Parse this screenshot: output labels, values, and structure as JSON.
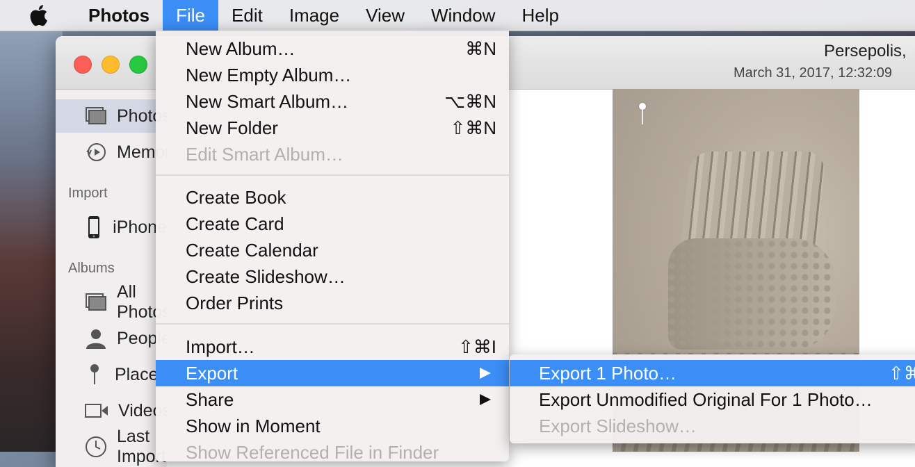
{
  "menubar": {
    "app_name": "Photos",
    "items": [
      "File",
      "Edit",
      "Image",
      "View",
      "Window",
      "Help"
    ]
  },
  "window": {
    "title": "Persepolis,",
    "subtitle": "March 31, 2017, 12:32:09"
  },
  "sidebar": {
    "items": [
      {
        "label": "Photos",
        "icon": "photos-icon",
        "selected": true
      },
      {
        "label": "Memories",
        "icon": "memories-icon"
      }
    ],
    "import_header": "Import",
    "import_items": [
      {
        "label": "iPhone",
        "icon": "iphone-icon"
      }
    ],
    "albums_header": "Albums",
    "album_items": [
      {
        "label": "All Photos",
        "icon": "all-photos-icon"
      },
      {
        "label": "People",
        "icon": "people-icon"
      },
      {
        "label": "Places",
        "icon": "places-icon"
      },
      {
        "label": "Videos",
        "icon": "videos-icon"
      },
      {
        "label": "Last Import",
        "icon": "clock-icon"
      }
    ]
  },
  "file_menu": {
    "group1": [
      {
        "label": "New Album…",
        "shortcut": "⌘N"
      },
      {
        "label": "New Empty Album…",
        "shortcut": ""
      },
      {
        "label": "New Smart Album…",
        "shortcut": "⌥⌘N"
      },
      {
        "label": "New Folder",
        "shortcut": "⇧⌘N"
      },
      {
        "label": "Edit Smart Album…",
        "shortcut": "",
        "disabled": true
      }
    ],
    "group2": [
      {
        "label": "Create Book"
      },
      {
        "label": "Create Card"
      },
      {
        "label": "Create Calendar"
      },
      {
        "label": "Create Slideshow…"
      },
      {
        "label": "Order Prints"
      }
    ],
    "group3": [
      {
        "label": "Import…",
        "shortcut": "⇧⌘I"
      },
      {
        "label": "Export",
        "submenu": true,
        "highlighted": true
      },
      {
        "label": "Share",
        "submenu": true
      },
      {
        "label": "Show in Moment"
      },
      {
        "label": "Show Referenced File in Finder",
        "disabled": true
      }
    ]
  },
  "export_submenu": [
    {
      "label": "Export 1 Photo…",
      "shortcut": "⇧⌘",
      "highlighted": true
    },
    {
      "label": "Export Unmodified Original For 1 Photo…"
    },
    {
      "label": "Export Slideshow…",
      "disabled": true
    }
  ],
  "colors": {
    "accent": "#3b8ef6",
    "menu_bg": "#f4f0f0",
    "disabled_text": "#b4b0b0"
  }
}
